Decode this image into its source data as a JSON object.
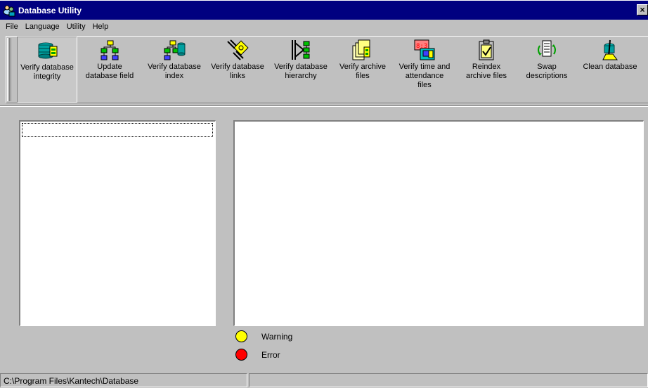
{
  "window": {
    "title": "Database Utility",
    "close_glyph": "×",
    "icon": "database-people-icon"
  },
  "menu": [
    {
      "label": "File"
    },
    {
      "label": "Language"
    },
    {
      "label": "Utility"
    },
    {
      "label": "Help"
    }
  ],
  "toolbar": [
    {
      "label": "Verify database\nintegrity",
      "icon": "database-stack-icon",
      "pressed": true
    },
    {
      "label": "Update\ndatabase field",
      "icon": "hierarchy-icon"
    },
    {
      "label": "Verify database\nindex",
      "icon": "hierarchy-database-icon"
    },
    {
      "label": "Verify database\nlinks",
      "icon": "chain-links-icon"
    },
    {
      "label": "Verify database\nhierarchy",
      "icon": "tree-hierarchy-icon"
    },
    {
      "label": "Verify archive\nfiles",
      "icon": "archive-files-icon"
    },
    {
      "label": "Verify time and\nattendance\nfiles",
      "icon": "time-attendance-icon"
    },
    {
      "label": "Reindex\narchive files",
      "icon": "clipboard-check-icon"
    },
    {
      "label": "Swap\ndescriptions",
      "icon": "swap-list-icon"
    },
    {
      "label": "Clean database",
      "icon": "broom-icon"
    }
  ],
  "legend": {
    "warning": {
      "label": "Warning",
      "color": "#ffff00"
    },
    "error": {
      "label": "Error",
      "color": "#ff0000"
    }
  },
  "status": {
    "path": "C:\\Program Files\\Kantech\\Database",
    "second": ""
  }
}
